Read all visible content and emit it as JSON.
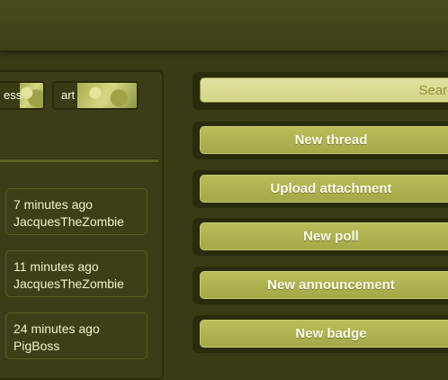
{
  "tags": [
    {
      "label": "ess"
    },
    {
      "label": "art"
    }
  ],
  "activity": [
    {
      "time": "7 minutes ago",
      "user": "JacquesTheZombie"
    },
    {
      "time": "11 minutes ago",
      "user": "JacquesTheZombie"
    },
    {
      "time": "24 minutes ago",
      "user": "PigBoss"
    }
  ],
  "search": {
    "placeholder": "Search"
  },
  "actions": {
    "new_thread": "New thread",
    "upload_attachment": "Upload attachment",
    "new_poll": "New poll",
    "new_announcement": "New announcement",
    "new_badge": "New badge"
  },
  "colors": {
    "background": "#3a3b14",
    "button": "#b1b653",
    "button_text": "#fdfde8",
    "search_field": "#d8db92"
  }
}
